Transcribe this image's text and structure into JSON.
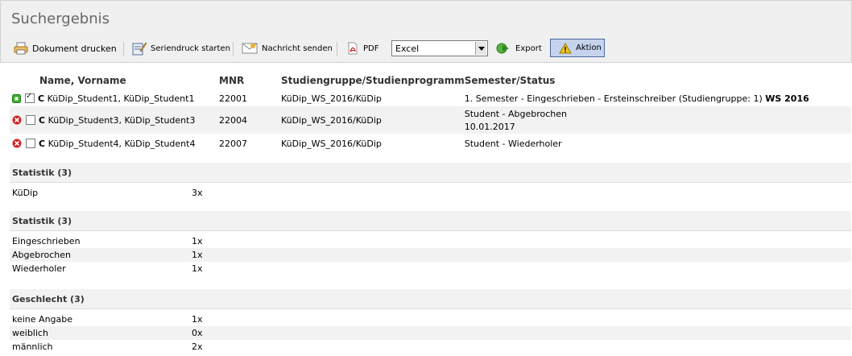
{
  "title": "Suchergebnis",
  "toolbar": {
    "print": "Dokument drucken",
    "seriendruck": "Seriendruck starten",
    "nachricht": "Nachricht senden",
    "pdf": "PDF",
    "format_value": "Excel",
    "export": "Export",
    "aktion": "Aktion"
  },
  "table": {
    "headers": [
      "Name, Vorname",
      "MNR",
      "Studiengruppe/Studienprogramm",
      "Semester/Status"
    ],
    "rows": [
      {
        "status_icon": "green-active-icon",
        "checked": true,
        "prefix": "C",
        "name": "KüDip_Student1, KüDip_Student1",
        "mnr": "22001",
        "gruppe": "KüDip_WS_2016/KüDip",
        "semester": "1. Semester - Eingeschrieben - Ersteinschreiber (Studiengruppe: 1)",
        "semester_bold": "WS 2016",
        "semester_line2": ""
      },
      {
        "status_icon": "red-cancel-icon",
        "checked": false,
        "prefix": "C",
        "name": "KüDip_Student3, KüDip_Student3",
        "mnr": "22004",
        "gruppe": "KüDip_WS_2016/KüDip",
        "semester": "Student - Abgebrochen",
        "semester_bold": "",
        "semester_line2": "10.01.2017"
      },
      {
        "status_icon": "red-cancel-icon",
        "checked": false,
        "prefix": "C",
        "name": "KüDip_Student4, KüDip_Student4",
        "mnr": "22007",
        "gruppe": "KüDip_WS_2016/KüDip",
        "semester": "Student - Wiederholer",
        "semester_bold": "",
        "semester_line2": ""
      }
    ]
  },
  "stats": [
    {
      "title": "Statistik (3)",
      "items": [
        {
          "label": "KüDip",
          "count": "3x"
        }
      ]
    },
    {
      "title": "Statistik (3)",
      "items": [
        {
          "label": "Eingeschrieben",
          "count": "1x"
        },
        {
          "label": "Abgebrochen",
          "count": "1x"
        },
        {
          "label": "Wiederholer",
          "count": "1x"
        }
      ]
    },
    {
      "title": "Geschlecht (3)",
      "items": [
        {
          "label": "keine Angabe",
          "count": "1x"
        },
        {
          "label": "weiblich",
          "count": "0x"
        },
        {
          "label": "männlich",
          "count": "2x"
        }
      ]
    }
  ]
}
